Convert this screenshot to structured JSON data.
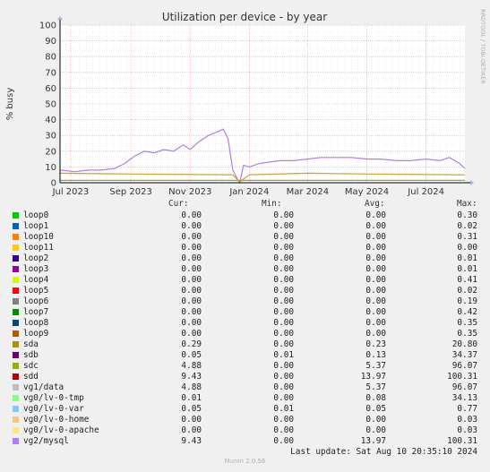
{
  "chart_data": {
    "type": "line",
    "title": "Utilization per device - by year",
    "ylabel": "% busy",
    "watermark": "RRDTOOL / TOBI OETIKER",
    "ylim": [
      0,
      100
    ],
    "yticks": [
      0,
      10,
      20,
      30,
      40,
      50,
      60,
      70,
      80,
      90,
      100
    ],
    "xlim": [
      "2023-06-20",
      "2024-08-10"
    ],
    "xticks": [
      {
        "date": "2023-07-01",
        "label": "Jul 2023"
      },
      {
        "date": "2023-09-01",
        "label": "Sep 2023"
      },
      {
        "date": "2023-11-01",
        "label": "Nov 2023"
      },
      {
        "date": "2024-01-01",
        "label": "Jan 2024"
      },
      {
        "date": "2024-03-01",
        "label": "Mar 2024"
      },
      {
        "date": "2024-05-01",
        "label": "May 2024"
      },
      {
        "date": "2024-07-01",
        "label": "Jul 2024"
      }
    ],
    "series_plot": [
      {
        "name": "vg2/mysql",
        "color": "#b07fe0",
        "x": [
          "2023-06-20",
          "2023-07-05",
          "2023-07-20",
          "2023-08-01",
          "2023-08-15",
          "2023-08-25",
          "2023-09-05",
          "2023-09-15",
          "2023-09-25",
          "2023-10-05",
          "2023-10-15",
          "2023-10-25",
          "2023-11-01",
          "2023-11-10",
          "2023-11-20",
          "2023-11-28",
          "2023-12-05",
          "2023-12-10",
          "2023-12-15",
          "2023-12-20",
          "2023-12-22",
          "2023-12-26",
          "2024-01-01",
          "2024-01-10",
          "2024-01-20",
          "2024-02-01",
          "2024-02-15",
          "2024-03-01",
          "2024-03-15",
          "2024-04-01",
          "2024-04-15",
          "2024-05-01",
          "2024-05-15",
          "2024-06-01",
          "2024-06-15",
          "2024-07-01",
          "2024-07-15",
          "2024-07-25",
          "2024-08-05",
          "2024-08-10"
        ],
        "values": [
          8,
          7,
          8,
          8,
          9,
          12,
          17,
          20,
          19,
          21,
          20,
          24,
          21,
          26,
          30,
          32,
          34,
          28,
          8,
          2,
          0,
          11,
          10,
          12,
          13,
          14,
          14,
          15,
          16,
          16,
          16,
          15,
          15,
          14,
          14,
          15,
          14,
          16,
          12,
          9
        ]
      },
      {
        "name": "sda",
        "color": "#c9a13a",
        "x": [
          "2023-06-20",
          "2023-09-01",
          "2023-12-15",
          "2023-12-22",
          "2024-01-01",
          "2024-03-01",
          "2024-05-01",
          "2024-08-10"
        ],
        "values": [
          6,
          5.5,
          5,
          0.5,
          5,
          6,
          5.5,
          5
        ]
      },
      {
        "name": "sdc",
        "color": "#8faa3a",
        "x": [
          "2023-06-20",
          "2023-12-15",
          "2024-01-01",
          "2024-08-10"
        ],
        "values": [
          1.5,
          1.5,
          1.5,
          1.5
        ]
      }
    ],
    "columns": [
      "Cur:",
      "Min:",
      "Avg:",
      "Max:"
    ],
    "series": [
      {
        "name": "loop0",
        "color": "#00cc00",
        "cur": "0.00",
        "min": "0.00",
        "avg": "0.00",
        "max": "0.30"
      },
      {
        "name": "loop1",
        "color": "#0066b3",
        "cur": "0.00",
        "min": "0.00",
        "avg": "0.00",
        "max": "0.02"
      },
      {
        "name": "loop10",
        "color": "#ff8000",
        "cur": "0.00",
        "min": "0.00",
        "avg": "0.00",
        "max": "0.31"
      },
      {
        "name": "loop11",
        "color": "#ffcc00",
        "cur": "0.00",
        "min": "0.00",
        "avg": "0.00",
        "max": "0.00"
      },
      {
        "name": "loop2",
        "color": "#330099",
        "cur": "0.00",
        "min": "0.00",
        "avg": "0.00",
        "max": "0.01"
      },
      {
        "name": "loop3",
        "color": "#990099",
        "cur": "0.00",
        "min": "0.00",
        "avg": "0.00",
        "max": "0.01"
      },
      {
        "name": "loop4",
        "color": "#ccff00",
        "cur": "0.00",
        "min": "0.00",
        "avg": "0.00",
        "max": "0.41"
      },
      {
        "name": "loop5",
        "color": "#ff0000",
        "cur": "0.00",
        "min": "0.00",
        "avg": "0.00",
        "max": "0.02"
      },
      {
        "name": "loop6",
        "color": "#808080",
        "cur": "0.00",
        "min": "0.00",
        "avg": "0.00",
        "max": "0.19"
      },
      {
        "name": "loop7",
        "color": "#008f00",
        "cur": "0.00",
        "min": "0.00",
        "avg": "0.00",
        "max": "0.42"
      },
      {
        "name": "loop8",
        "color": "#00487d",
        "cur": "0.00",
        "min": "0.00",
        "avg": "0.00",
        "max": "0.35"
      },
      {
        "name": "loop9",
        "color": "#b35a00",
        "cur": "0.00",
        "min": "0.00",
        "avg": "0.00",
        "max": "0.35"
      },
      {
        "name": "sda",
        "color": "#b38f00",
        "cur": "0.29",
        "min": "0.00",
        "avg": "0.23",
        "max": "20.80"
      },
      {
        "name": "sdb",
        "color": "#6b006b",
        "cur": "0.05",
        "min": "0.01",
        "avg": "0.13",
        "max": "34.37"
      },
      {
        "name": "sdc",
        "color": "#8fb300",
        "cur": "4.88",
        "min": "0.00",
        "avg": "5.37",
        "max": "96.07"
      },
      {
        "name": "sdd",
        "color": "#b30000",
        "cur": "9.43",
        "min": "0.00",
        "avg": "13.97",
        "max": "100.31"
      },
      {
        "name": "vg1/data",
        "color": "#bebebe",
        "cur": "4.88",
        "min": "0.00",
        "avg": "5.37",
        "max": "96.07"
      },
      {
        "name": "vg0/lv-0-tmp",
        "color": "#80ff80",
        "cur": "0.01",
        "min": "0.00",
        "avg": "0.08",
        "max": "34.13"
      },
      {
        "name": "vg0/lv-0-var",
        "color": "#80c9ff",
        "cur": "0.05",
        "min": "0.01",
        "avg": "0.05",
        "max": "0.77"
      },
      {
        "name": "vg0/lv-0-home",
        "color": "#ffc080",
        "cur": "0.00",
        "min": "0.00",
        "avg": "0.00",
        "max": "0.03"
      },
      {
        "name": "vg0/lv-0-apache",
        "color": "#ffe680",
        "cur": "0.00",
        "min": "0.00",
        "avg": "0.00",
        "max": "0.03"
      },
      {
        "name": "vg2/mysql",
        "color": "#aa80ff",
        "cur": "9.43",
        "min": "0.00",
        "avg": "13.97",
        "max": "100.31"
      }
    ],
    "last_update": "Last update: Sat Aug 10 20:35:10 2024",
    "footer": "Munin 2.0.56"
  }
}
